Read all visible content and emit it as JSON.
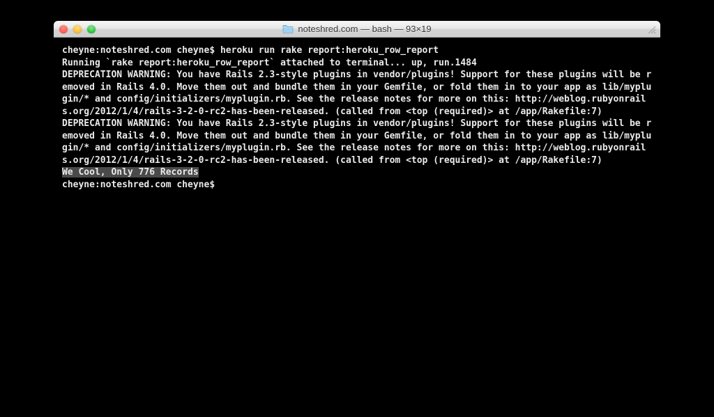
{
  "window": {
    "title": "noteshred.com — bash — 93×19",
    "folder_icon": "folder-icon",
    "buttons": {
      "close": "close-button",
      "minimize": "minimize-button",
      "zoom": "zoom-button"
    }
  },
  "terminal": {
    "lines": [
      {
        "text": "cheyne:noteshred.com cheyne$ heroku run rake report:heroku_row_report",
        "highlight": false
      },
      {
        "text": "Running `rake report:heroku_row_report` attached to terminal... up, run.1484",
        "highlight": false
      },
      {
        "text": "DEPRECATION WARNING: You have Rails 2.3-style plugins in vendor/plugins! Support for these plugins will be removed in Rails 4.0. Move them out and bundle them in your Gemfile, or fold them in to your app as lib/myplugin/* and config/initializers/myplugin.rb. See the release notes for more on this: http://weblog.rubyonrails.org/2012/1/4/rails-3-2-0-rc2-has-been-released. (called from <top (required)> at /app/Rakefile:7)",
        "highlight": false
      },
      {
        "text": "DEPRECATION WARNING: You have Rails 2.3-style plugins in vendor/plugins! Support for these plugins will be removed in Rails 4.0. Move them out and bundle them in your Gemfile, or fold them in to your app as lib/myplugin/* and config/initializers/myplugin.rb. See the release notes for more on this: http://weblog.rubyonrails.org/2012/1/4/rails-3-2-0-rc2-has-been-released. (called from <top (required)> at /app/Rakefile:7)",
        "highlight": false
      },
      {
        "text": "We Cool, Only 776 Records",
        "highlight": true
      },
      {
        "text": "cheyne:noteshred.com cheyne$ ",
        "highlight": false
      }
    ]
  }
}
